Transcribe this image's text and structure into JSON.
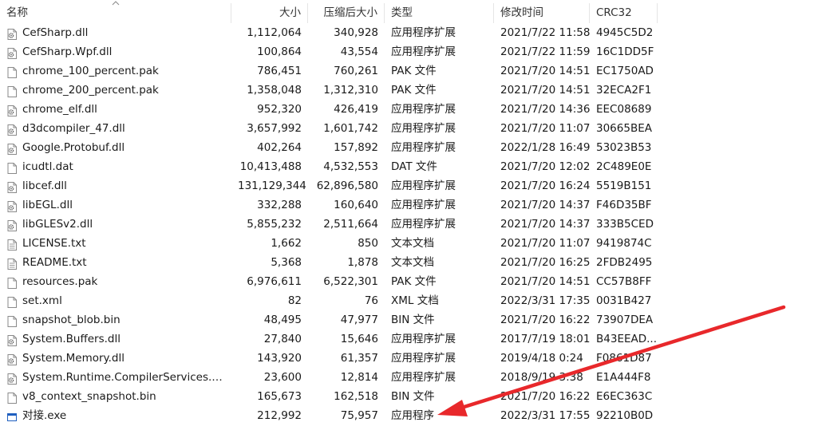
{
  "columns": {
    "name": "名称",
    "size": "大小",
    "packed": "压缩后大小",
    "type": "类型",
    "modified": "修改时间",
    "crc": "CRC32"
  },
  "files": [
    {
      "name": "CefSharp.dll",
      "size": "1,112,064",
      "packed": "340,928",
      "type": "应用程序扩展",
      "modified": "2021/7/22 11:58",
      "crc": "4945C5D2",
      "icon": "dll-gear-icon"
    },
    {
      "name": "CefSharp.Wpf.dll",
      "size": "100,864",
      "packed": "43,554",
      "type": "应用程序扩展",
      "modified": "2021/7/22 11:59",
      "crc": "16C1DD5F",
      "icon": "dll-gear-icon"
    },
    {
      "name": "chrome_100_percent.pak",
      "size": "786,451",
      "packed": "760,261",
      "type": "PAK 文件",
      "modified": "2021/7/20 14:51",
      "crc": "EC1750AD",
      "icon": "file-icon"
    },
    {
      "name": "chrome_200_percent.pak",
      "size": "1,358,048",
      "packed": "1,312,310",
      "type": "PAK 文件",
      "modified": "2021/7/20 14:51",
      "crc": "32ECA2F1",
      "icon": "file-icon"
    },
    {
      "name": "chrome_elf.dll",
      "size": "952,320",
      "packed": "426,419",
      "type": "应用程序扩展",
      "modified": "2021/7/20 14:36",
      "crc": "EEC08689",
      "icon": "dll-gear-icon"
    },
    {
      "name": "d3dcompiler_47.dll",
      "size": "3,657,992",
      "packed": "1,601,742",
      "type": "应用程序扩展",
      "modified": "2021/7/20 11:07",
      "crc": "30665BEA",
      "icon": "dll-gear-icon"
    },
    {
      "name": "Google.Protobuf.dll",
      "size": "402,264",
      "packed": "157,892",
      "type": "应用程序扩展",
      "modified": "2022/1/28 16:49",
      "crc": "53023B53",
      "icon": "dll-gear-icon"
    },
    {
      "name": "icudtl.dat",
      "size": "10,413,488",
      "packed": "4,532,553",
      "type": "DAT 文件",
      "modified": "2021/7/20 12:02",
      "crc": "2C489E0E",
      "icon": "file-icon"
    },
    {
      "name": "libcef.dll",
      "size": "131,129,344",
      "packed": "62,896,580",
      "type": "应用程序扩展",
      "modified": "2021/7/20 16:24",
      "crc": "5519B151",
      "icon": "dll-gear-icon"
    },
    {
      "name": "libEGL.dll",
      "size": "332,288",
      "packed": "160,640",
      "type": "应用程序扩展",
      "modified": "2021/7/20 14:37",
      "crc": "F46D35BF",
      "icon": "dll-gear-icon"
    },
    {
      "name": "libGLESv2.dll",
      "size": "5,855,232",
      "packed": "2,511,664",
      "type": "应用程序扩展",
      "modified": "2021/7/20 14:37",
      "crc": "333B5CED",
      "icon": "dll-gear-icon"
    },
    {
      "name": "LICENSE.txt",
      "size": "1,662",
      "packed": "850",
      "type": "文本文档",
      "modified": "2021/7/20 11:07",
      "crc": "9419874C",
      "icon": "text-file-icon"
    },
    {
      "name": "README.txt",
      "size": "5,368",
      "packed": "1,878",
      "type": "文本文档",
      "modified": "2021/7/20 16:25",
      "crc": "2FDB2495",
      "icon": "text-file-icon"
    },
    {
      "name": "resources.pak",
      "size": "6,976,611",
      "packed": "6,522,301",
      "type": "PAK 文件",
      "modified": "2021/7/20 14:51",
      "crc": "CC57B8FF",
      "icon": "file-icon"
    },
    {
      "name": "set.xml",
      "size": "82",
      "packed": "76",
      "type": "XML 文档",
      "modified": "2022/3/31 17:35",
      "crc": "0031B427",
      "icon": "file-icon"
    },
    {
      "name": "snapshot_blob.bin",
      "size": "48,495",
      "packed": "47,977",
      "type": "BIN 文件",
      "modified": "2021/7/20 16:22",
      "crc": "73907DEA",
      "icon": "file-icon"
    },
    {
      "name": "System.Buffers.dll",
      "size": "27,840",
      "packed": "15,646",
      "type": "应用程序扩展",
      "modified": "2017/7/19 18:01",
      "crc": "B43EEAD...",
      "icon": "dll-gear-icon"
    },
    {
      "name": "System.Memory.dll",
      "size": "143,920",
      "packed": "61,357",
      "type": "应用程序扩展",
      "modified": "2019/4/18 0:24",
      "crc": "F0861D87",
      "icon": "dll-gear-icon"
    },
    {
      "name": "System.Runtime.CompilerServices.Un...",
      "size": "23,600",
      "packed": "12,814",
      "type": "应用程序扩展",
      "modified": "2018/9/19 3:38",
      "crc": "E1A444F8",
      "icon": "dll-gear-icon"
    },
    {
      "name": "v8_context_snapshot.bin",
      "size": "165,673",
      "packed": "162,518",
      "type": "BIN 文件",
      "modified": "2021/7/20 16:22",
      "crc": "E6EC363C",
      "icon": "file-icon"
    },
    {
      "name": "对接.exe",
      "size": "212,992",
      "packed": "75,957",
      "type": "应用程序",
      "modified": "2022/3/31 17:55",
      "crc": "92210B0D",
      "icon": "exe-window-icon"
    }
  ],
  "colors": {
    "arrow": "#e8282b",
    "header_divider": "#e5e5e5",
    "exe_icon": "#1f5fbf"
  }
}
